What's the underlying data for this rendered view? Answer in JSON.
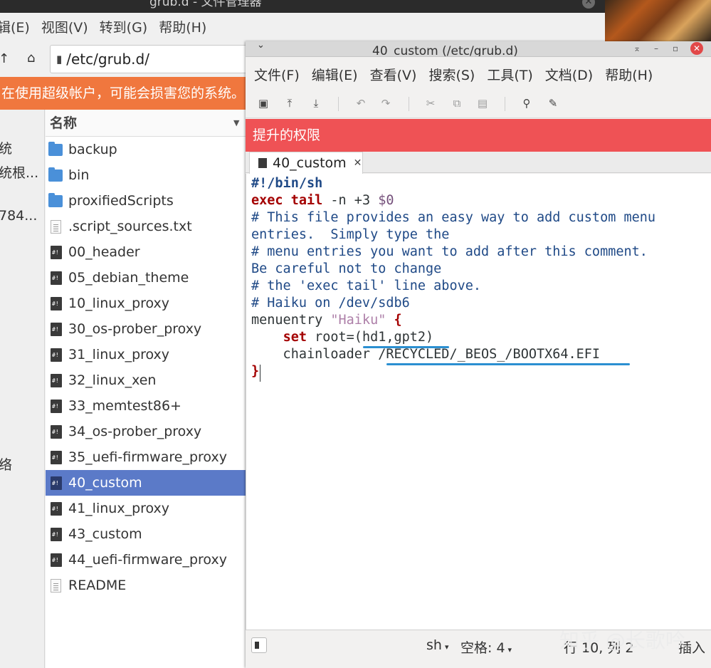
{
  "file_manager": {
    "title": "grub.d - 文件管理器",
    "menu": [
      "辑(E)",
      "视图(V)",
      "转到(G)",
      "帮助(H)"
    ],
    "location": "/etc/grub.d/",
    "warning": "在使用超级帐户，可能会损害您的系统。",
    "sidebar": [
      "统",
      "统根...",
      "784...",
      "络"
    ],
    "column_header": "名称",
    "files": [
      {
        "name": "backup",
        "type": "folder"
      },
      {
        "name": "bin",
        "type": "folder"
      },
      {
        "name": "proxifiedScripts",
        "type": "folder"
      },
      {
        "name": ".script_sources.txt",
        "type": "text"
      },
      {
        "name": "00_header",
        "type": "script"
      },
      {
        "name": "05_debian_theme",
        "type": "script"
      },
      {
        "name": "10_linux_proxy",
        "type": "script"
      },
      {
        "name": "30_os-prober_proxy",
        "type": "script"
      },
      {
        "name": "31_linux_proxy",
        "type": "script"
      },
      {
        "name": "32_linux_xen",
        "type": "script"
      },
      {
        "name": "33_memtest86+",
        "type": "script"
      },
      {
        "name": "34_os-prober_proxy",
        "type": "script"
      },
      {
        "name": "35_uefi-firmware_proxy",
        "type": "script"
      },
      {
        "name": "40_custom",
        "type": "script",
        "selected": true
      },
      {
        "name": "41_linux_proxy",
        "type": "script"
      },
      {
        "name": "43_custom",
        "type": "script"
      },
      {
        "name": "44_uefi-firmware_proxy",
        "type": "script"
      },
      {
        "name": "README",
        "type": "text"
      }
    ]
  },
  "editor": {
    "title": "40_custom (/etc/grub.d)",
    "menu": [
      "文件(F)",
      "编辑(E)",
      "查看(V)",
      "搜索(S)",
      "工具(T)",
      "文档(D)",
      "帮助(H)"
    ],
    "privilege_bar": "提升的权限",
    "tab_label": "40_custom",
    "code": {
      "l1": "#!/bin/sh",
      "l2_kw": "exec tail",
      "l2_rest": " -n +3 ",
      "l2_var": "$0",
      "l3": "# This file provides an easy way to add custom menu",
      "l4": "entries.  Simply type the",
      "l5": "# menu entries you want to add after this comment.",
      "l6": "Be careful not to change",
      "l7": "# the 'exec tail' line above.",
      "l8": "# Haiku on /dev/sdb6",
      "l9_a": "menuentry ",
      "l9_str": "\"Haiku\"",
      "l9_brace": " {",
      "l10_indent": "    ",
      "l10_kw": "set",
      "l10_rest": " root=(hd1,gpt2)",
      "l11": "    chainloader /RECYCLED/_BEOS_/BOOTX64.EFI",
      "l12": "}"
    },
    "status": {
      "language": "sh",
      "spaces": "空格: 4",
      "position": "行 10, 列 2",
      "mode": "插入"
    }
  },
  "watermark": "知乎 @长歌吟",
  "colors": {
    "warning_orange": "#f0773e",
    "privilege_red": "#ef5255",
    "selection_blue": "#5b7ac8",
    "underline_blue": "#2b8fd1",
    "folder_blue": "#4a90d9"
  }
}
